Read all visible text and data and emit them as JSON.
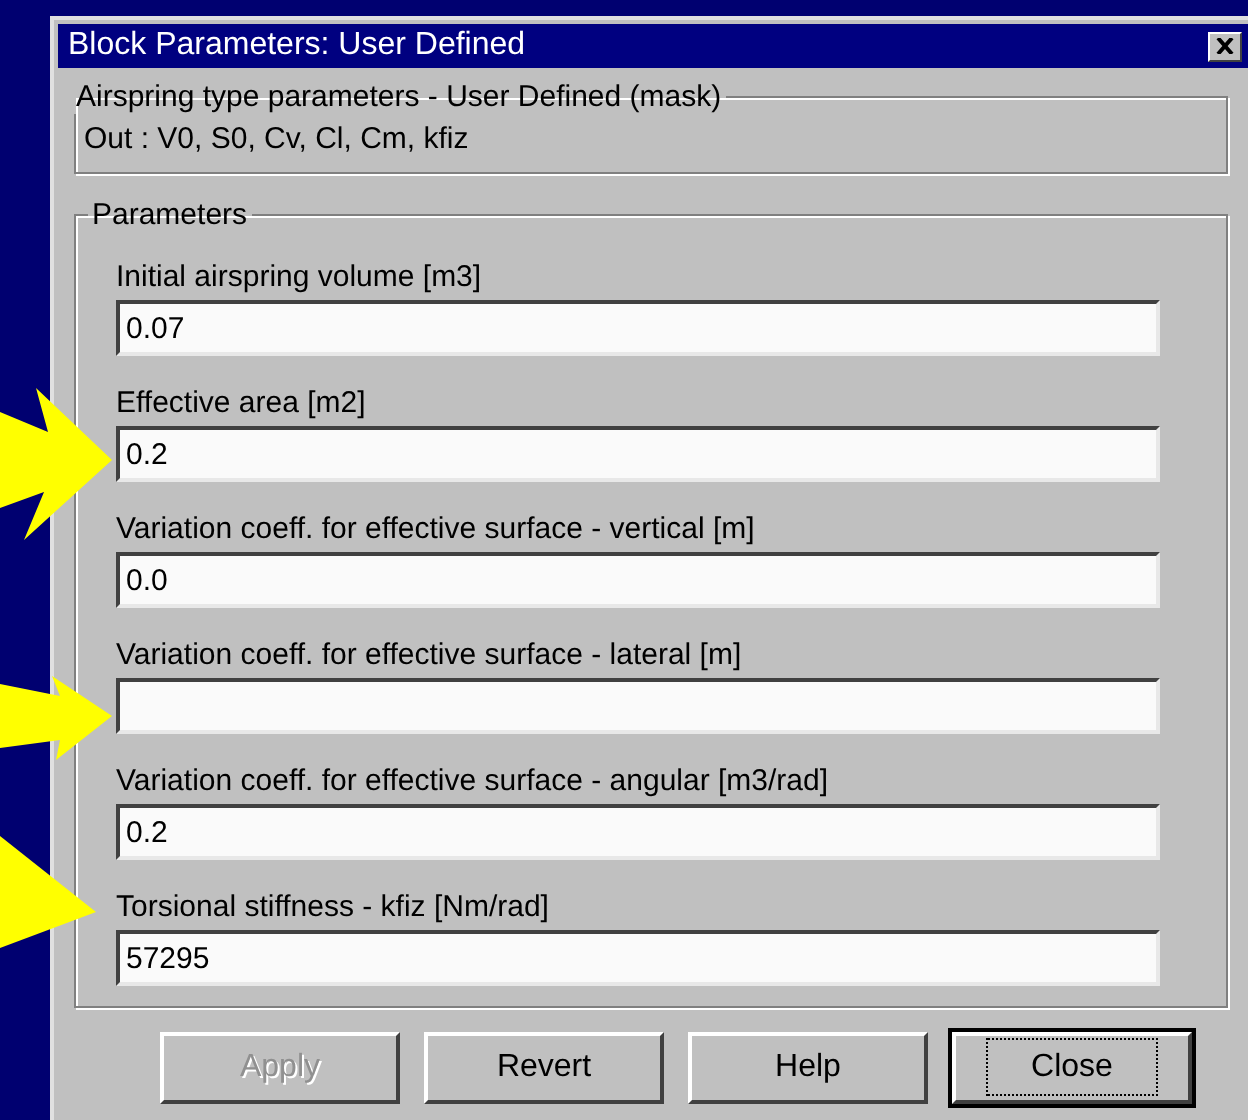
{
  "window": {
    "title": "Block Parameters: User Defined"
  },
  "mask_group": {
    "title": "Airspring type parameters - User Defined (mask)",
    "description": "Out : V0, S0, Cv, Cl, Cm, kfiz"
  },
  "parameters": {
    "title": "Parameters",
    "fields": [
      {
        "label": "Initial airspring volume [m3]",
        "value": "0.07"
      },
      {
        "label": "Effective area [m2]",
        "value": "0.2"
      },
      {
        "label": "Variation coeff. for effective surface - vertical [m]",
        "value": "0.0"
      },
      {
        "label": "Variation coeff. for effective surface - lateral [m]"
      },
      {
        "label": "Variation coeff. for effective surface - angular [m3/rad]",
        "value": "0.2"
      },
      {
        "label": "Torsional stiffness - kfiz [Nm/rad]",
        "value": "57295"
      }
    ]
  },
  "buttons": [
    {
      "label": "Apply",
      "disabled": true,
      "focused": false
    },
    {
      "label": "Revert",
      "disabled": false,
      "focused": false
    },
    {
      "label": "Help",
      "disabled": false,
      "focused": false
    },
    {
      "label": "Close",
      "disabled": false,
      "focused": true
    }
  ]
}
